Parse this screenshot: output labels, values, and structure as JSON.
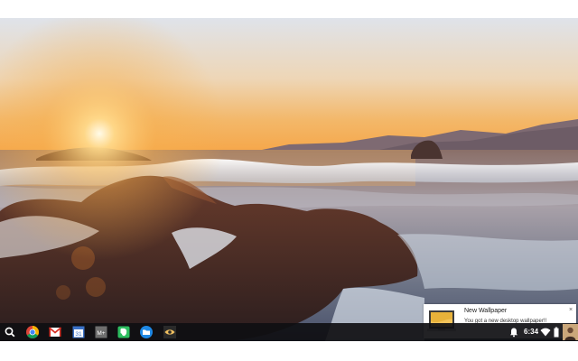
{
  "desktop": {
    "wallpaper": "sunset-coastline-waves-rocks"
  },
  "shelf": {
    "launcher_icon": "search-icon",
    "apps": [
      {
        "name": "chrome-icon"
      },
      {
        "name": "gmail-icon"
      },
      {
        "name": "calendar-icon",
        "label": "31"
      },
      {
        "name": "google-plus-icon",
        "label": "M+"
      },
      {
        "name": "evernote-icon"
      },
      {
        "name": "files-icon"
      },
      {
        "name": "eye-icon"
      }
    ],
    "tray": {
      "time": "6:34",
      "icons": [
        "notification-bell-icon",
        "wifi-icon",
        "battery-icon",
        "avatar"
      ]
    }
  },
  "notification": {
    "title": "New Wallpaper",
    "body": "You got a new desktop wallpaper!!",
    "close": "×",
    "thumbnail_icon": "laptop-icon"
  },
  "colors": {
    "shelf": "#0f0f12",
    "notification_bg": "#ffffff",
    "sky_warm": "#f6b55a"
  }
}
